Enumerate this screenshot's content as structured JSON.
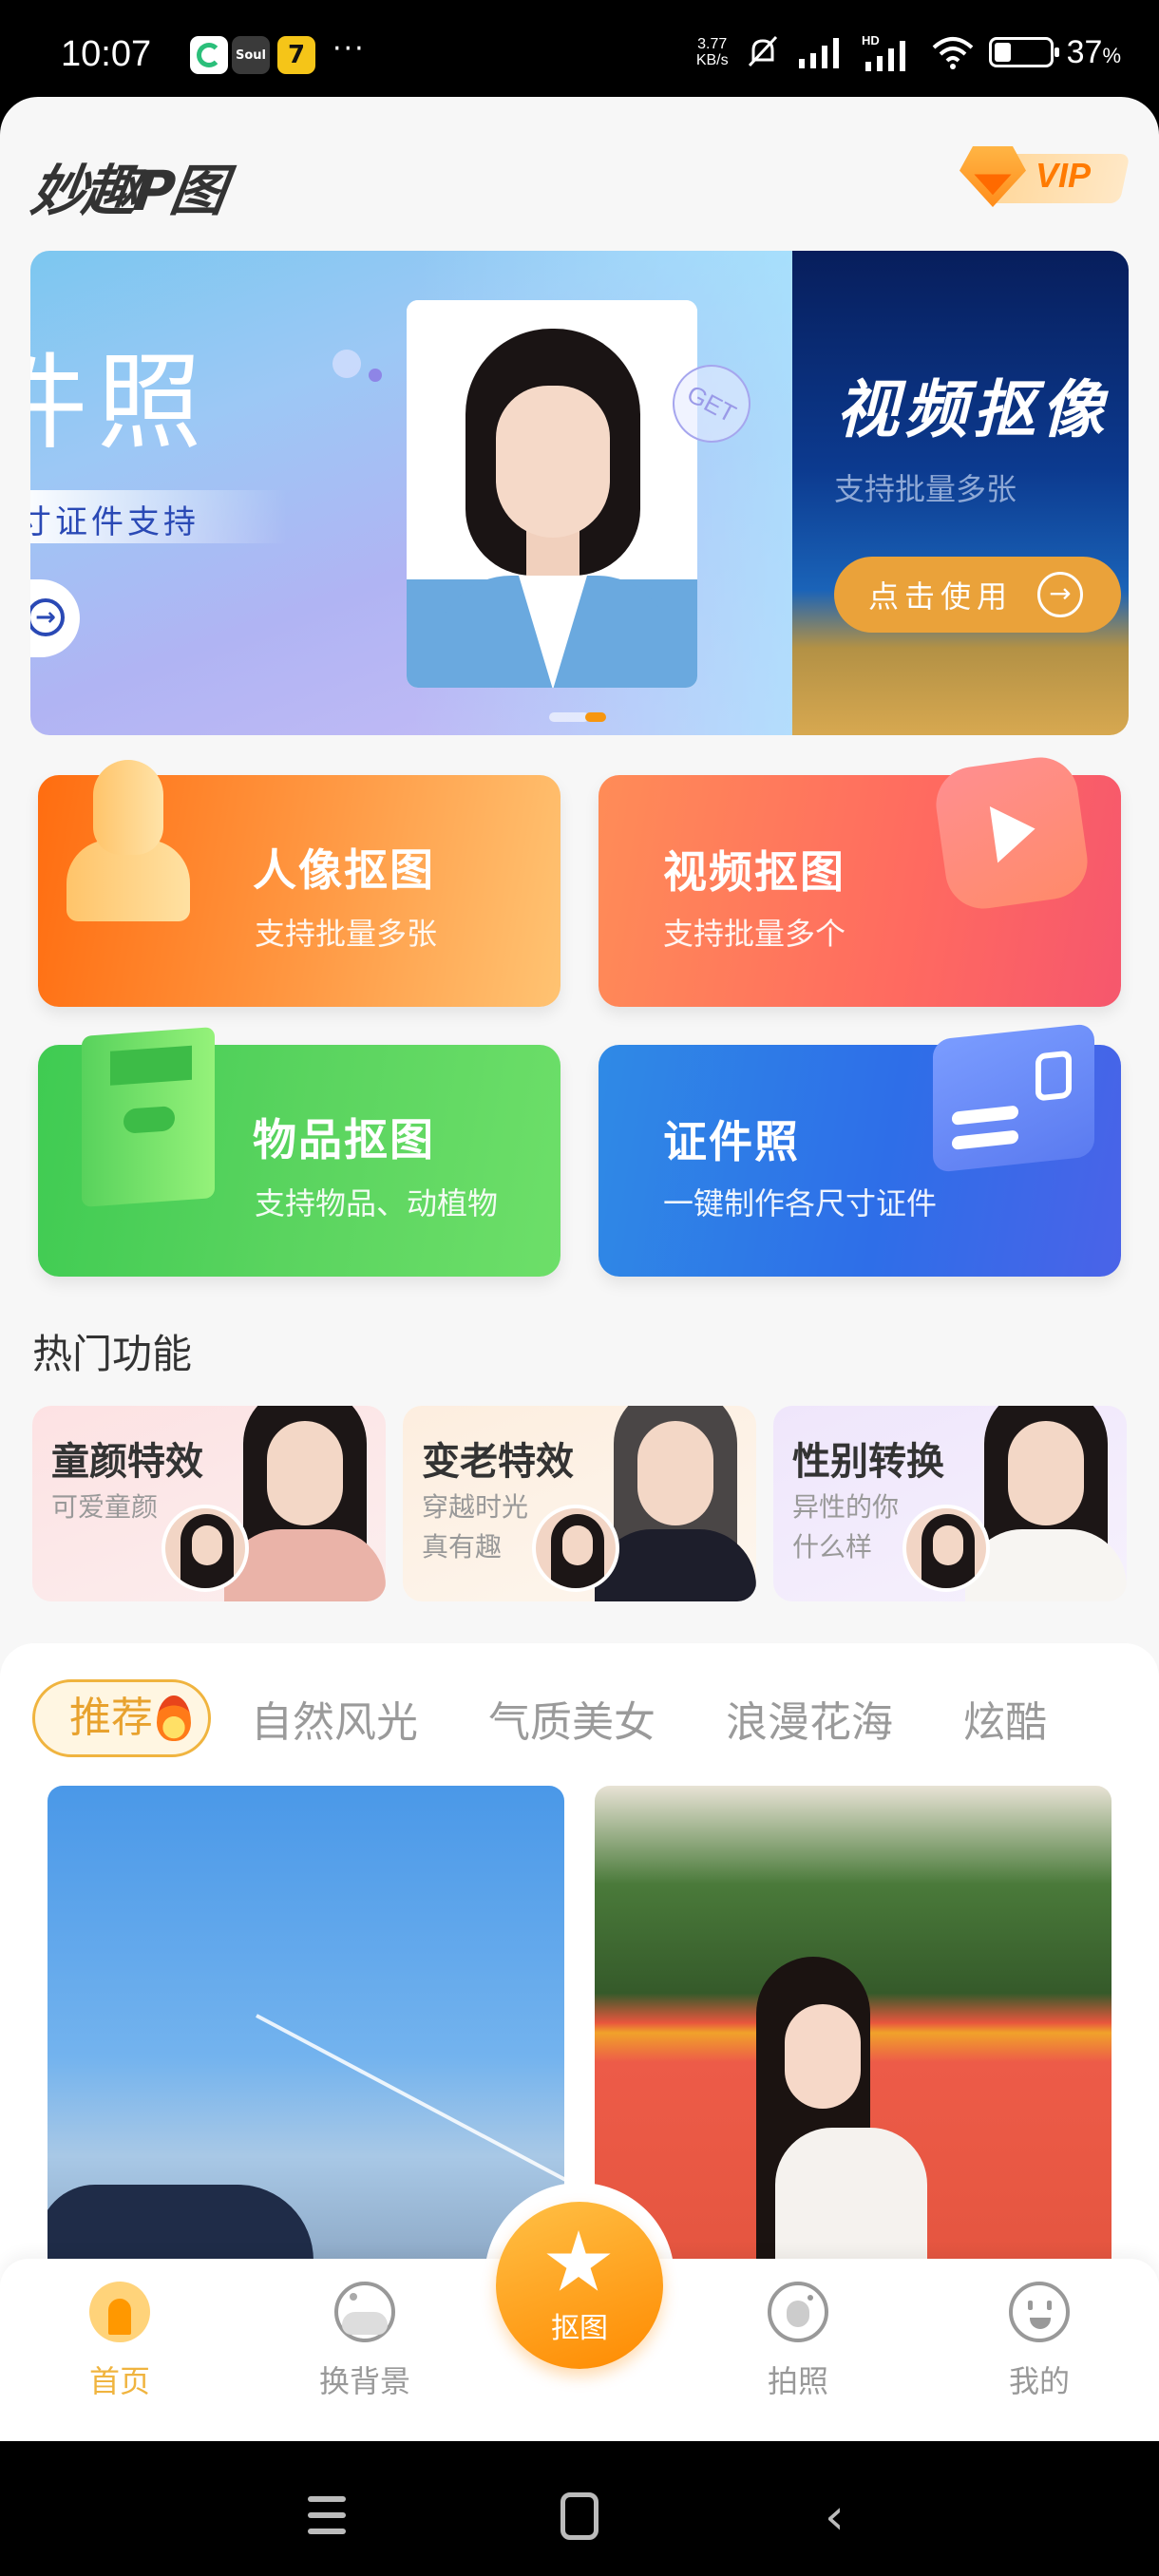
{
  "status_bar": {
    "time": "10:07",
    "apps": [
      {
        "name": "green-swirl-app-icon",
        "label": ""
      },
      {
        "name": "soul-app-icon",
        "label": "Soul"
      },
      {
        "name": "cat-7-app-icon",
        "label": "7"
      }
    ],
    "more": "···",
    "net_speed_value": "3.77",
    "net_speed_unit": "KB/s",
    "battery_percent": "37",
    "battery_suffix": "%",
    "battery_level": 0.37
  },
  "header": {
    "logo": "妙趣P图",
    "vip_label": "VIP"
  },
  "banner": {
    "slides": [
      {
        "title": "件照",
        "subtitle": "寸证件支持",
        "badge": "GET",
        "button_icon": "→"
      },
      {
        "title": "视频抠像",
        "subtitle": "支持批量多张",
        "button_label": "点击使用",
        "button_icon": "→"
      }
    ],
    "active_index": 1,
    "total": 2
  },
  "features": [
    {
      "title": "人像抠图",
      "subtitle": "支持批量多张",
      "icon": "portrait-bust-icon"
    },
    {
      "title": "视频抠图",
      "subtitle": "支持批量多个",
      "icon": "video-play-icon"
    },
    {
      "title": "物品抠图",
      "subtitle": "支持物品、动植物",
      "icon": "box-icon"
    },
    {
      "title": "证件照",
      "subtitle": "一键制作各尺寸证件",
      "icon": "id-card-icon"
    }
  ],
  "hot": {
    "title": "热门功能",
    "items": [
      {
        "title": "童颜特效",
        "desc": "可爱童颜"
      },
      {
        "title": "变老特效",
        "desc": "穿越时光真有趣"
      },
      {
        "title": "性别转换",
        "desc": "异性的你什么样"
      }
    ]
  },
  "gallery": {
    "tabs": [
      "推荐",
      "自然风光",
      "气质美女",
      "浪漫花海",
      "炫酷"
    ],
    "active_tab": 0
  },
  "tabbar": {
    "items": [
      {
        "label": "首页",
        "active": true
      },
      {
        "label": "换背景",
        "active": false
      },
      {
        "label": "抠图",
        "active": false
      },
      {
        "label": "拍照",
        "active": false
      },
      {
        "label": "我的",
        "active": false
      }
    ]
  },
  "colors": {
    "accent": "#f0b43f",
    "accent_orange": "#ff8a00",
    "text_primary": "#333333",
    "text_secondary": "#999999"
  }
}
